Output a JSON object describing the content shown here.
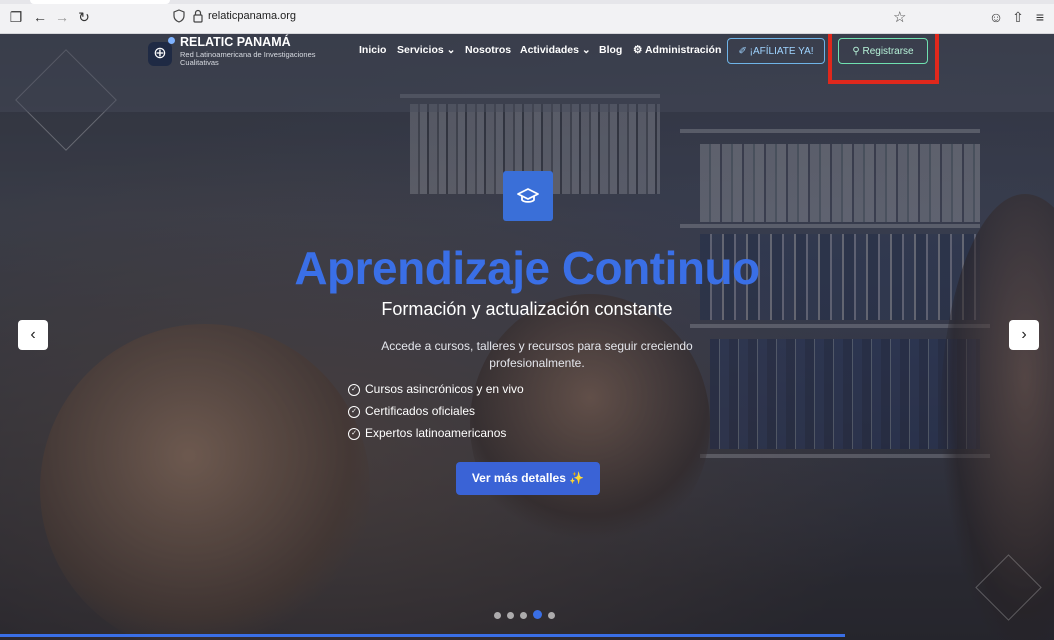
{
  "browser": {
    "url": "relaticpanama.org"
  },
  "brand": {
    "title": "RELATIC PANAMÁ",
    "subtitle": "Red Latinoamericana de Investigaciones Cualitativas"
  },
  "nav": {
    "items": [
      "Inicio",
      "Servicios",
      "Nosotros",
      "Actividades",
      "Blog",
      "Administración"
    ],
    "afiliate_label": "¡AFÍLIATE YA!",
    "register_label": "Registrarse"
  },
  "hero": {
    "headline": "Aprendizaje Continuo",
    "subheadline": "Formación y actualización constante",
    "description": "Accede a cursos, talleres y recursos para seguir creciendo profesionalmente.",
    "features": [
      "Cursos asincrónicos y en vivo",
      "Certificados oficiales",
      "Expertos latinoamericanos"
    ],
    "cta_label": "Ver más detalles ✨",
    "slide_count": 5,
    "active_slide": 4
  },
  "colors": {
    "accent": "#3a6fe6",
    "highlight_box": "#e0281c",
    "register_border": "#6fe0b0",
    "afiliate_border": "#6fb4e8"
  }
}
